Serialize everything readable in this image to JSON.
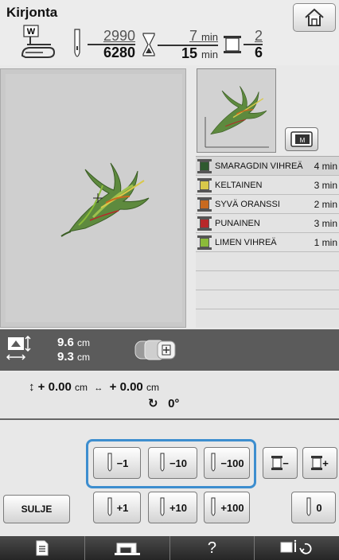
{
  "header": {
    "title": "Kirjonta",
    "presser_foot_letter": "W",
    "stitches": {
      "current": "2990",
      "total": "6280"
    },
    "time": {
      "current": "7",
      "total": "15",
      "unit": "min"
    },
    "colors": {
      "current": "2",
      "total": "6"
    }
  },
  "threads": [
    {
      "name": "SMARAGDIN VIHREÄ",
      "time": "4 min",
      "color": "#2f5a2f"
    },
    {
      "name": "KELTAINEN",
      "time": "3 min",
      "color": "#d9c84a"
    },
    {
      "name": "SYVÄ ORANSSI",
      "time": "2 min",
      "color": "#c86a1f"
    },
    {
      "name": "PUNAINEN",
      "time": "3 min",
      "color": "#b8282a"
    },
    {
      "name": "LIMEN VIHREÄ",
      "time": "1 min",
      "color": "#8bbb3a"
    }
  ],
  "size": {
    "height": "9.6",
    "width": "9.3",
    "unit": "cm"
  },
  "position": {
    "y": "+ 0.00",
    "x": "+ 0.00",
    "unit": "cm",
    "angle": "0°"
  },
  "buttons": {
    "back_1": "−1",
    "back_10": "−10",
    "back_100": "−100",
    "fwd_1": "+1",
    "fwd_10": "+10",
    "fwd_100": "+100",
    "reset": "0",
    "close": "SULJE",
    "thread_minus": "−",
    "thread_plus": "+"
  },
  "footer": {
    "help": "?"
  },
  "colors": {
    "selection_outline": "#3d8ecf",
    "size_bar": "#5b5b5b",
    "footer": "#2d2d2d"
  }
}
